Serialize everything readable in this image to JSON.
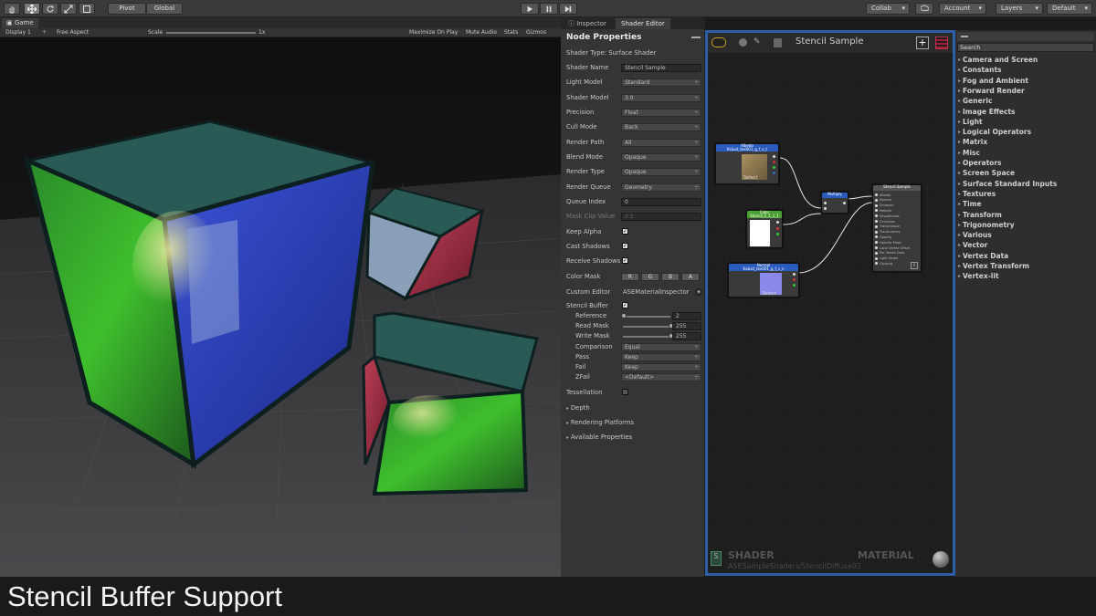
{
  "toolbar": {
    "tools": [
      "hand-tool",
      "move-tool",
      "rotate-tool",
      "scale-tool",
      "rect-tool"
    ],
    "pivot_label": "Pivot",
    "global_label": "Global",
    "play_controls": [
      "play",
      "pause",
      "step"
    ],
    "collab_label": "Collab",
    "account_label": "Account",
    "layers_label": "Layers",
    "layout_label": "Default"
  },
  "game": {
    "tab_label": "Game",
    "display": "Display 1",
    "aspect": "Free Aspect",
    "scale_label": "Scale",
    "scale_value": "1x",
    "maximize": "Maximize On Play",
    "mute": "Mute Audio",
    "stats": "Stats",
    "gizmos": "Gizmos"
  },
  "inspector": {
    "tabs": [
      "Inspector",
      "Shader Editor"
    ],
    "title": "Node Properties",
    "shader_type": "Shader Type: Surface Shader",
    "props": [
      {
        "label": "Shader Name",
        "value": "Stencil Sample"
      },
      {
        "label": "Light Model",
        "value": "Standard"
      },
      {
        "label": "Shader Model",
        "value": "3.0"
      },
      {
        "label": "Precision",
        "value": "Float"
      },
      {
        "label": "Cull Mode",
        "value": "Back"
      },
      {
        "label": "Render Path",
        "value": "All"
      },
      {
        "label": "Blend Mode",
        "value": "Opaque"
      },
      {
        "label": "Render Type",
        "value": "Opaque"
      },
      {
        "label": "Render Queue",
        "value": "Geometry"
      },
      {
        "label": "Queue Index",
        "value": "0"
      },
      {
        "label": "Mask Clip Value",
        "value": "0.5"
      }
    ],
    "keep_alpha": "Keep Alpha",
    "cast_shadows": "Cast Shadows",
    "receive_shadows": "Receive Shadows",
    "color_mask": "Color Mask",
    "color_mask_channels": [
      "R",
      "G",
      "B",
      "A"
    ],
    "custom_editor_label": "Custom Editor",
    "custom_editor_value": "ASEMaterialInspector",
    "stencil_buffer": "Stencil Buffer",
    "stencil": {
      "reference_label": "Reference",
      "reference_value": "2",
      "reference_level": 0.0,
      "read_label": "Read Mask",
      "read_value": "255",
      "read_level": 1.0,
      "write_label": "Write Mask",
      "write_value": "255",
      "write_level": 1.0,
      "comparison_label": "Comparison",
      "comparison_value": "Equal",
      "pass_label": "Pass",
      "pass_value": "Keep",
      "fail_label": "Fail",
      "fail_value": "Keep",
      "zfail_label": "ZFail",
      "zfail_value": "<Default>"
    },
    "tessellation": "Tessellation",
    "folds": [
      "Depth",
      "Rendering Platforms",
      "Available Properties"
    ]
  },
  "graph": {
    "title": "Stencil Sample",
    "shader_label": "SHADER",
    "material_label": "MATERIAL",
    "footer_path": "ASESampleShaders/StencilDiffuse02",
    "nodes": {
      "albedo": "Albedo",
      "albedo_sub": "Ks&sd_tex001_g_f_s_t",
      "albedo_select": "Select",
      "color": "Color",
      "color_sub": "Stencil_1_1_1_1",
      "multiply": "Multiply",
      "normal": "Normal",
      "normal_sub": "Ks&sd_tex001_g_f_s_n",
      "normal_select": "Select",
      "output": "Stencil Sample",
      "output_ports": [
        "Albedo",
        "Normal",
        "Emission",
        "Metallic",
        "Smoothness",
        "Occlusion",
        "Transmission",
        "Translucency",
        "Opacity",
        "Opacity Mask",
        "Local Vertex Offset",
        "Per Vertex Data",
        "Light Model",
        "Clipping"
      ]
    },
    "accent": "#2f5ea8"
  },
  "palette": {
    "search_label": "Search",
    "categories": [
      "Camera and Screen",
      "Constants",
      "Fog and Ambient",
      "Forward Render",
      "Generic",
      "Image Effects",
      "Light",
      "Logical Operators",
      "Matrix",
      "Misc",
      "Operators",
      "Screen Space",
      "Surface Standard Inputs",
      "Textures",
      "Time",
      "Transform",
      "Trigonometry",
      "Various",
      "Vector",
      "Vertex Data",
      "Vertex Transform",
      "Vertex-lit"
    ]
  },
  "caption": "Stencil Buffer Support"
}
